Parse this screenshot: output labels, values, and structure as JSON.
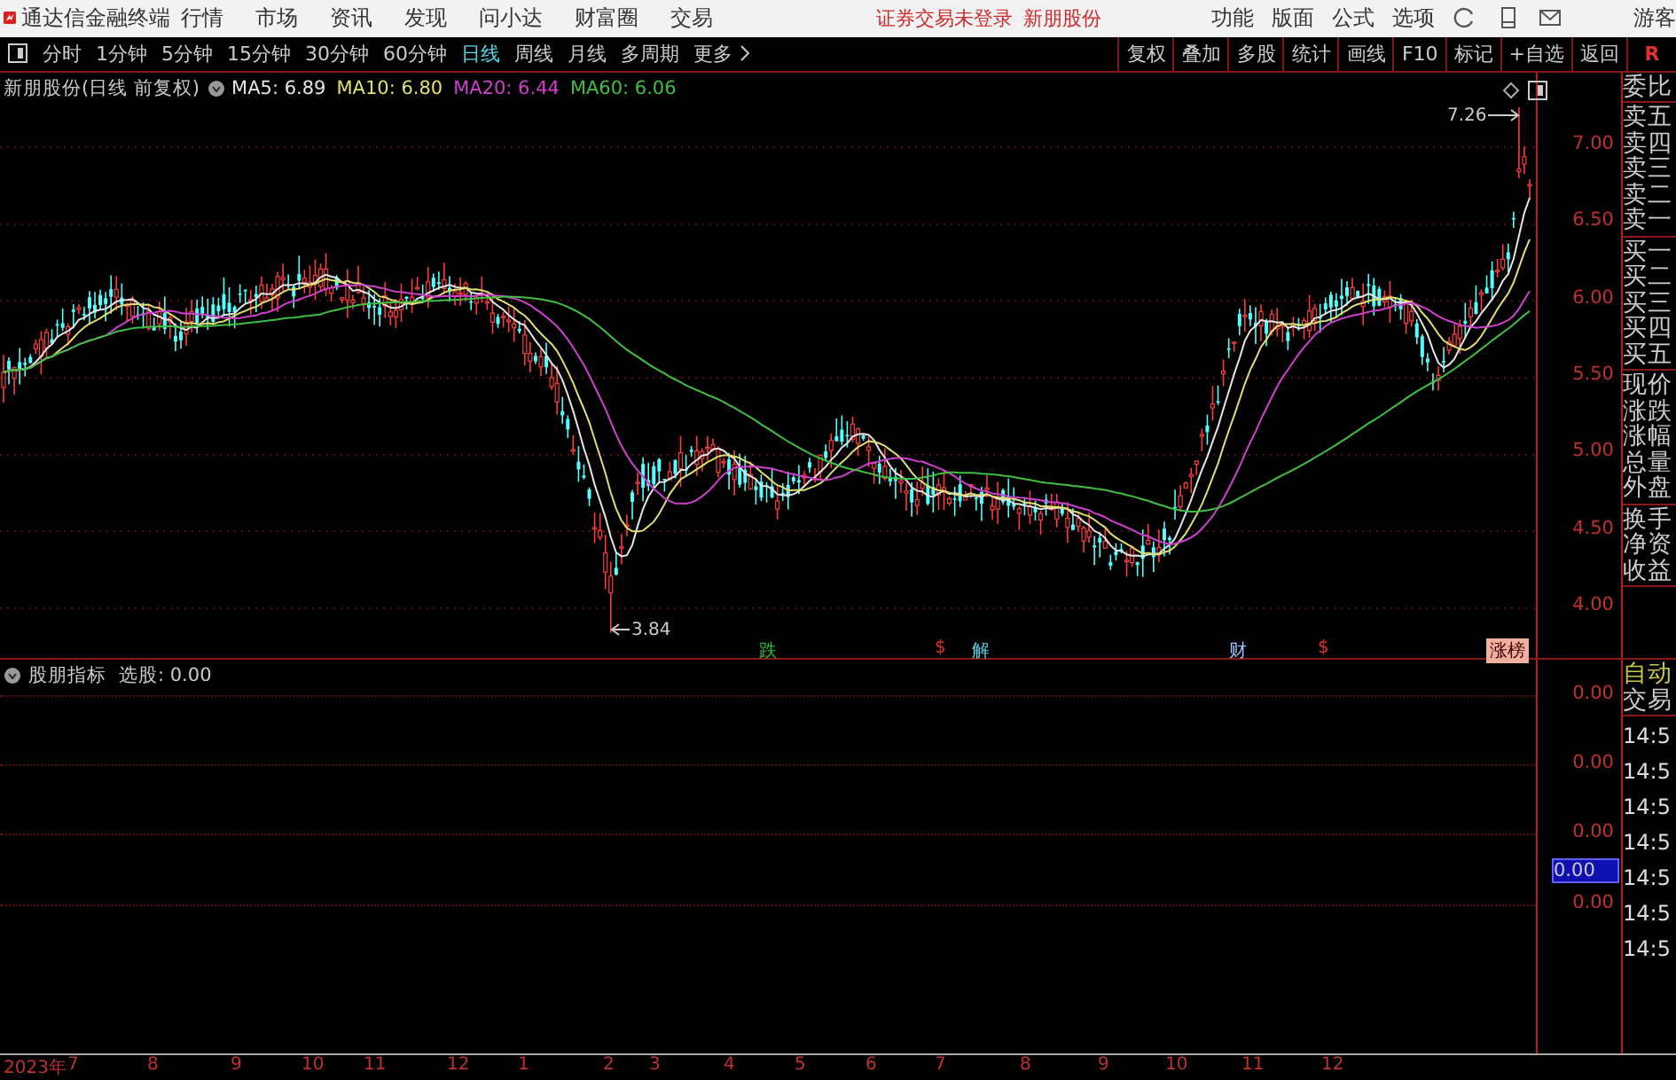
{
  "menubar": {
    "app_title": "通达信金融终端",
    "menu": [
      "行情",
      "市场",
      "资讯",
      "发现",
      "问小达",
      "财富圈",
      "交易"
    ],
    "login_status": "证券交易未登录",
    "stock_name": "新朋股份",
    "tools": [
      "功能",
      "版面",
      "公式",
      "选项"
    ],
    "user": "游客"
  },
  "toolbar": {
    "periods": [
      {
        "label": "分时",
        "selected": false
      },
      {
        "label": "1分钟",
        "selected": false
      },
      {
        "label": "5分钟",
        "selected": false
      },
      {
        "label": "15分钟",
        "selected": false
      },
      {
        "label": "30分钟",
        "selected": false
      },
      {
        "label": "60分钟",
        "selected": false
      },
      {
        "label": "日线",
        "selected": true
      },
      {
        "label": "周线",
        "selected": false
      },
      {
        "label": "月线",
        "selected": false
      },
      {
        "label": "多周期",
        "selected": false
      }
    ],
    "more": "更多",
    "actions": [
      "复权",
      "叠加",
      "多股",
      "统计",
      "画线",
      "F10",
      "标记",
      "+自选",
      "返回"
    ],
    "corner": "R"
  },
  "price_chart": {
    "title": "新朋股份(日线 前复权)",
    "ma": [
      {
        "label": "MA5: 6.89",
        "color": "#e6e6e6"
      },
      {
        "label": "MA10: 6.80",
        "color": "#e0e070"
      },
      {
        "label": "MA20: 6.44",
        "color": "#d040d0"
      },
      {
        "label": "MA60: 6.06",
        "color": "#40c040"
      }
    ],
    "y_ticks": [
      "7.00",
      "6.50",
      "6.00",
      "5.50",
      "5.00",
      "4.50",
      "4.00"
    ],
    "high_label": "7.26",
    "low_label": "3.84",
    "events": [
      {
        "label": "跌",
        "kind": "tag",
        "color": "#30c030"
      },
      {
        "label": "$",
        "kind": "tag",
        "color": "#e03030"
      },
      {
        "label": "解",
        "kind": "tag",
        "color": "#60d0e0"
      },
      {
        "label": "财",
        "kind": "tag",
        "color": "#a0c8ff"
      },
      {
        "label": "$",
        "kind": "tag",
        "color": "#e03030"
      },
      {
        "label": "涨榜",
        "kind": "badge",
        "color": "#f0b0a0"
      }
    ]
  },
  "quote_panel": {
    "groups": [
      {
        "labels": [
          "委比"
        ]
      },
      {
        "labels": [
          "卖五",
          "卖四",
          "卖三",
          "卖二",
          "卖一"
        ]
      },
      {
        "labels": [
          "买一",
          "买二",
          "买三",
          "买四",
          "买五"
        ]
      },
      {
        "labels": [
          "现价",
          "涨跌",
          "涨幅",
          "总量",
          "外盘"
        ]
      },
      {
        "labels": [
          "换手",
          "净资",
          "收益"
        ]
      }
    ]
  },
  "indicator": {
    "name": "股朋指标",
    "value": "选股: 0.00",
    "y_ticks": [
      "0.00",
      "0.00",
      "0.00",
      "0.00"
    ],
    "cursor_value": "0.00"
  },
  "trade_panel": {
    "header": [
      "自动",
      "交易"
    ],
    "times": [
      "14:5",
      "14:5",
      "14:5",
      "14:5",
      "14:5",
      "14:5",
      "14:5"
    ]
  },
  "x_axis": {
    "labels": [
      "2023年",
      "7",
      "8",
      "9",
      "10",
      "11",
      "12",
      "1",
      "2",
      "3",
      "4",
      "5",
      "6",
      "7",
      "8",
      "9",
      "10",
      "11",
      "12"
    ]
  }
}
